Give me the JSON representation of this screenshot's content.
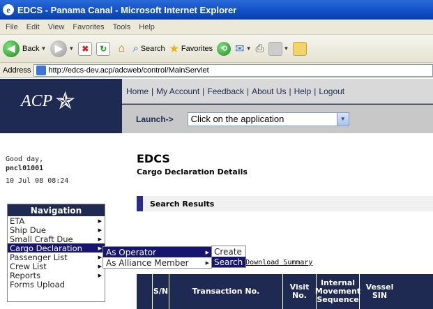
{
  "window": {
    "title": "EDCS - Panama Canal - Microsoft Internet Explorer"
  },
  "menubar": [
    "File",
    "Edit",
    "View",
    "Favorites",
    "Tools",
    "Help"
  ],
  "toolbar": {
    "back_label": "Back",
    "search_label": "Search",
    "favorites_label": "Favorites"
  },
  "address": {
    "label": "Address",
    "url": "http://edcs-dev.acp/adcweb/control/MainServlet"
  },
  "brand": {
    "logo_text": "ACP",
    "logo_star": "✯"
  },
  "topnav": [
    "Home",
    "My Account",
    "Feedback",
    "About Us",
    "Help",
    "Logout"
  ],
  "launch": {
    "label": "Launch->",
    "selected": "Click on the application"
  },
  "greeting": {
    "line1": "Good day,",
    "user": "pncl01001",
    "datetime": "10 Jul 08 08:24"
  },
  "page": {
    "title": "EDCS",
    "subtitle": "Cargo Declaration Details"
  },
  "results": {
    "title": "Search Results"
  },
  "links": {
    "partial": "d",
    "download": "Download Summary"
  },
  "table": {
    "headers": [
      "S/N",
      "Transaction No.",
      "Visit No.",
      "Internal Movement Sequence",
      "Vessel SIN"
    ]
  },
  "navigation": {
    "title": "Navigation",
    "items": [
      {
        "label": "ETA",
        "has_sub": true
      },
      {
        "label": "Ship Due",
        "has_sub": true
      },
      {
        "label": "Small Craft Due",
        "has_sub": true
      },
      {
        "label": "Cargo Declaration",
        "has_sub": true
      },
      {
        "label": "Passenger List",
        "has_sub": true
      },
      {
        "label": "Crew List",
        "has_sub": true
      },
      {
        "label": "Reports",
        "has_sub": true
      },
      {
        "label": "Forms Upload",
        "has_sub": false
      }
    ]
  },
  "submenu1": [
    "As Operator",
    "As Alliance Member"
  ],
  "submenu2": [
    "Create",
    "Search"
  ],
  "colors": {
    "header_navy": "#1e2a52",
    "menu_highlight": "#16166e",
    "titlebar_blue": "#0f4fc4"
  }
}
